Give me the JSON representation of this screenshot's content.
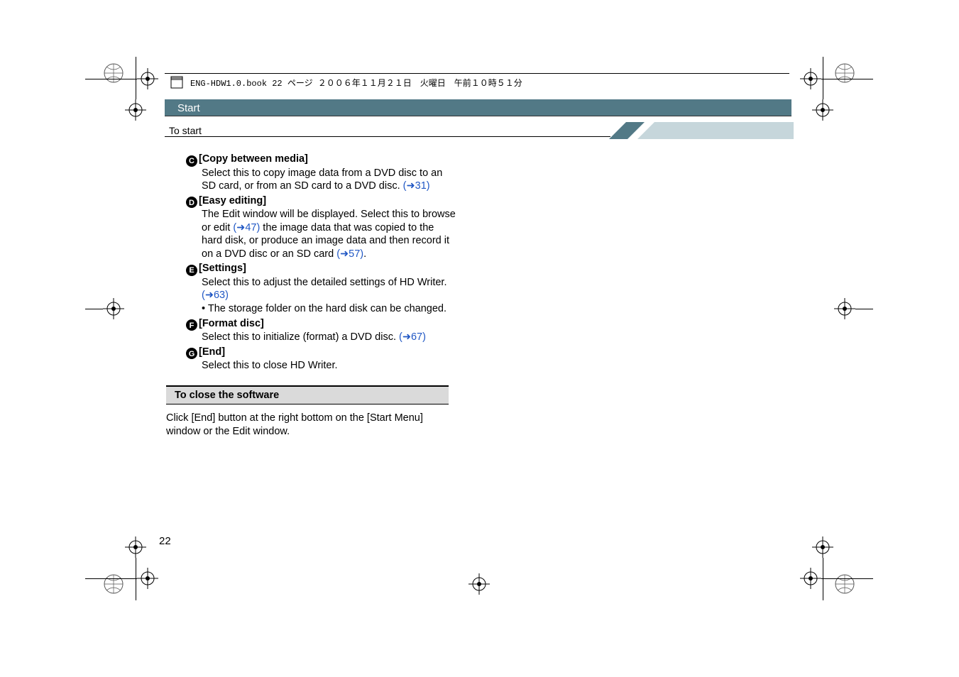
{
  "book_header": "ENG-HDW1.0.book  22 ページ  ２００６年１１月２１日　火曜日　午前１０時５１分",
  "start_label": "Start",
  "tostart_label": "To start",
  "items": {
    "c": {
      "letter": "C",
      "title": "[Copy between media]",
      "body1": "Select this to copy image data from a DVD disc to an SD card, or from an SD card to a DVD disc. ",
      "ref1": "(➜31)"
    },
    "d": {
      "letter": "D",
      "title": "[Easy editing]",
      "body1": "The Edit window will be displayed. Select this to browse or edit ",
      "ref1": "(➜47)",
      "body2": " the image data that was copied to the hard disk, or produce an image data and then record it on a DVD disc or an SD card ",
      "ref2": "(➜57)",
      "body3": "."
    },
    "e": {
      "letter": "E",
      "title": "[Settings]",
      "body1": "Select this to adjust the detailed settings of HD Writer. ",
      "ref1": "(➜63)",
      "bullet": "The storage folder on the hard disk can be changed."
    },
    "f": {
      "letter": "F",
      "title": "[Format disc]",
      "body1": "Select this to initialize (format) a DVD disc. ",
      "ref1": "(➜67)"
    },
    "g": {
      "letter": "G",
      "title": "[End]",
      "body1": "Select this to close HD Writer."
    }
  },
  "close_header": "To close the software",
  "close_body": "Click [End] button at the right bottom on the [Start Menu] window or the Edit window.",
  "page_number": "22"
}
